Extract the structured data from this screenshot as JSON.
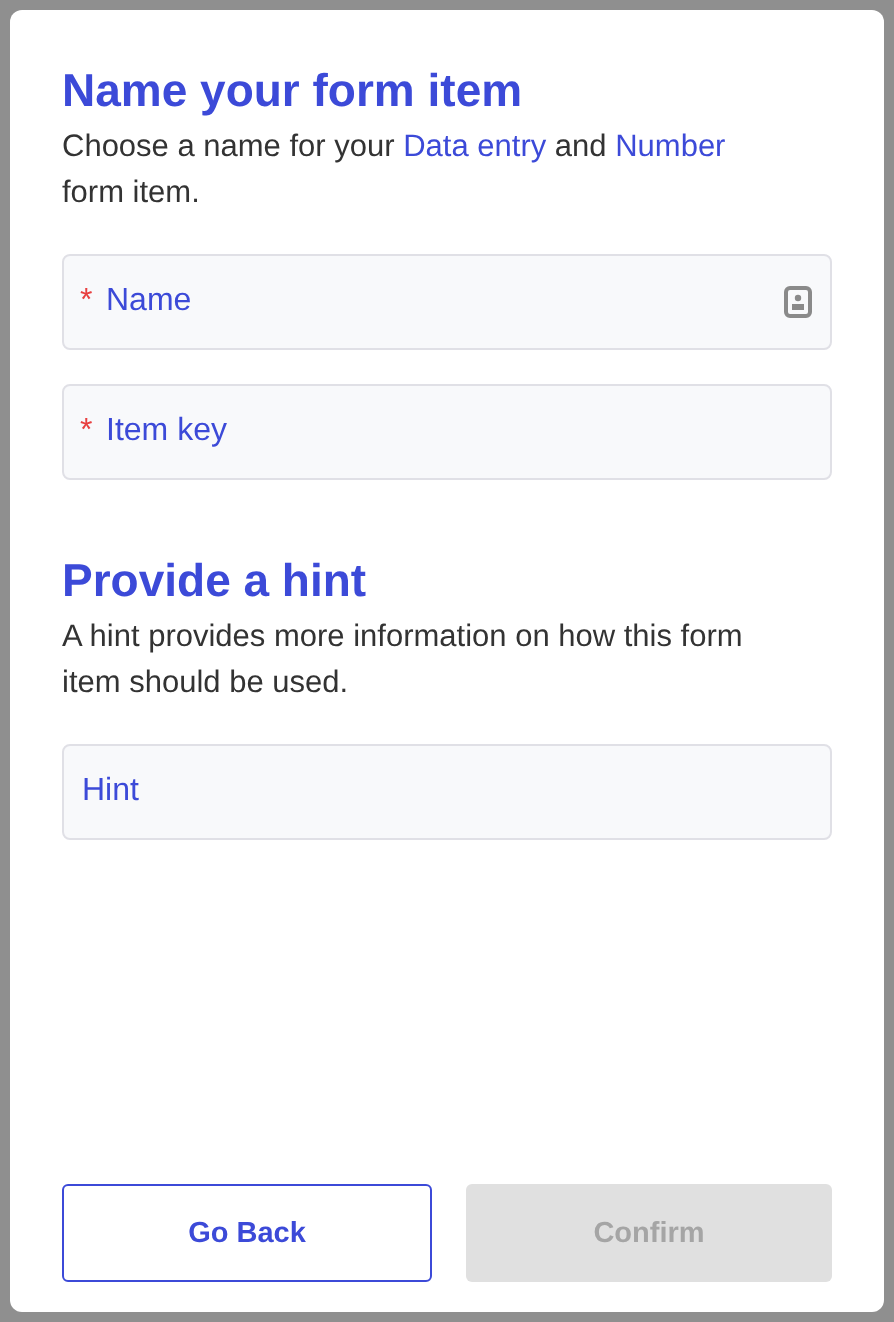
{
  "sections": [
    {
      "title": "Name your form item",
      "description": [
        {
          "text": "Choose a name for your ",
          "kind": "plain"
        },
        {
          "text": "Data entry",
          "kind": "highlight"
        },
        {
          "text": " and ",
          "kind": "plain"
        },
        {
          "text": "Number",
          "kind": "highlight"
        },
        {
          "text": " form item.",
          "kind": "plain"
        }
      ],
      "fields": [
        {
          "placeholder": "Name",
          "required_mark": "*",
          "contact_icon": true
        },
        {
          "placeholder": "Item key",
          "required_mark": "*",
          "contact_icon": false
        }
      ]
    },
    {
      "title": "Provide a hint",
      "description": [
        {
          "text": "A hint provides more information on how this form item should be used.",
          "kind": "plain"
        }
      ],
      "fields": [
        {
          "placeholder": "Hint",
          "contact_icon": false
        }
      ]
    }
  ],
  "buttons": [
    {
      "label": "Go Back",
      "kind": "outline",
      "disabled": false
    },
    {
      "label": "Confirm",
      "kind": "filled",
      "disabled": true
    }
  ]
}
